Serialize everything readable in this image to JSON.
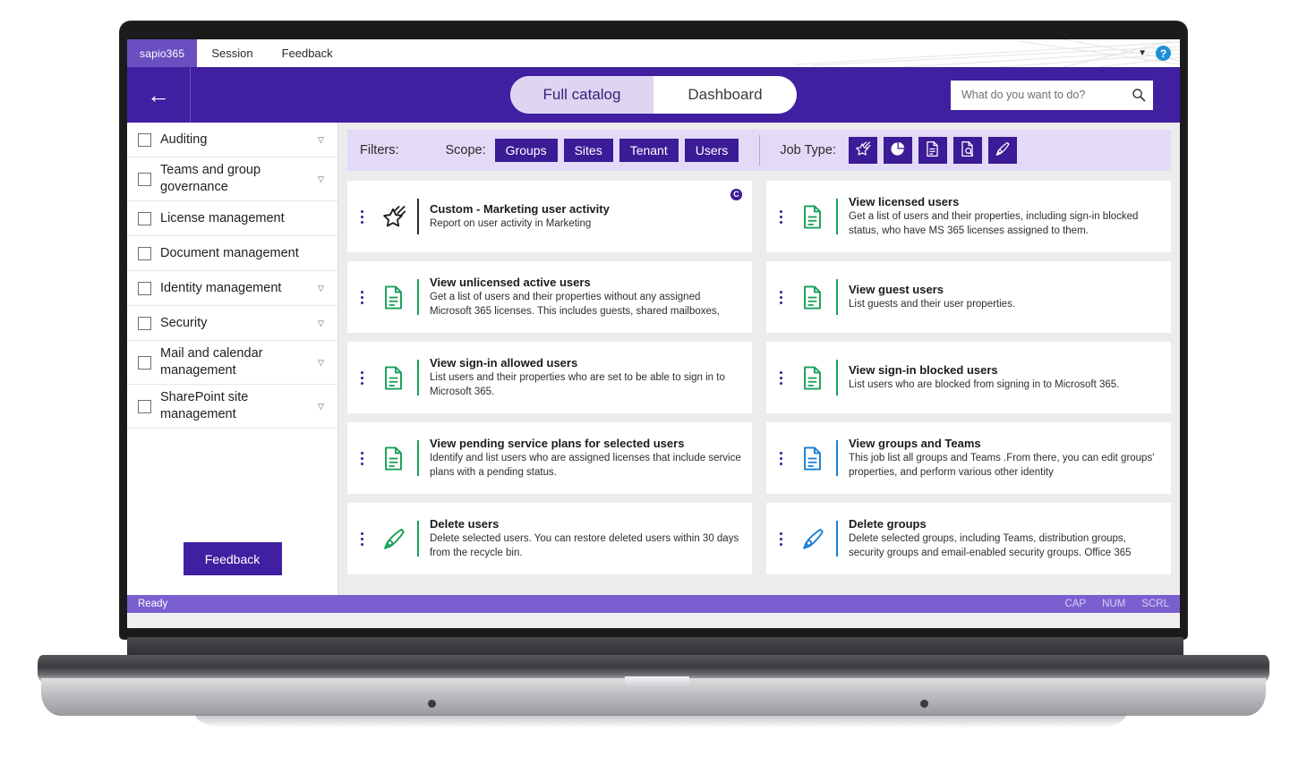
{
  "menubar": {
    "brand": "sapio365",
    "items": [
      "Session",
      "Feedback"
    ],
    "help_icon": "help-circle-icon",
    "chevron_icon": "chevron-down-icon"
  },
  "header": {
    "back_icon": "back-arrow-icon",
    "tabs": [
      {
        "label": "Full catalog",
        "active": true
      },
      {
        "label": "Dashboard",
        "active": false
      }
    ],
    "search": {
      "placeholder": "What do you want to do?",
      "value": "",
      "icon": "search-icon"
    },
    "accent_color": "#4020a0"
  },
  "sidebar": {
    "items": [
      {
        "label": "Auditing",
        "checked": false,
        "has_chevron": true,
        "two_line": false
      },
      {
        "label": "Teams and group governance",
        "checked": false,
        "has_chevron": true,
        "two_line": true
      },
      {
        "label": "License management",
        "checked": false,
        "has_chevron": false,
        "two_line": false
      },
      {
        "label": "Document management",
        "checked": false,
        "has_chevron": false,
        "two_line": false
      },
      {
        "label": "Identity management",
        "checked": false,
        "has_chevron": true,
        "two_line": false
      },
      {
        "label": "Security",
        "checked": false,
        "has_chevron": true,
        "two_line": false
      },
      {
        "label": "Mail and calendar management",
        "checked": false,
        "has_chevron": true,
        "two_line": true
      },
      {
        "label": "SharePoint site management",
        "checked": false,
        "has_chevron": true,
        "two_line": true
      }
    ],
    "feedback_button": "Feedback"
  },
  "filters": {
    "filters_label": "Filters:",
    "scope_label": "Scope:",
    "scope_chips": [
      "Groups",
      "Sites",
      "Tenant",
      "Users"
    ],
    "jobtype_label": "Job Type:",
    "jobtype_icons": [
      "shooting-star-icon",
      "pie-chart-icon",
      "document-icon",
      "document-search-icon",
      "pen-edit-icon"
    ],
    "chip_color": "#3b1b96",
    "bar_color": "#e2daf6"
  },
  "cards": [
    {
      "title": "Custom - Marketing user activity",
      "description": "Report on user activity in Marketing",
      "icon": "shooting-star-icon",
      "icon_color": "#1b1b1b",
      "badge": "C",
      "column": "left"
    },
    {
      "title": "View licensed users",
      "description": "Get a list of users and their properties, including sign-in blocked status, who have MS 365 licenses assigned to them.",
      "icon": "document-icon",
      "icon_color": "#17a05a",
      "badge": "",
      "column": "right"
    },
    {
      "title": "View unlicensed active users",
      "description": "Get a list of users and their properties without any assigned Microsoft 365 licenses. This includes guests, shared mailboxes,",
      "icon": "document-icon",
      "icon_color": "#17a05a",
      "badge": "",
      "column": "left"
    },
    {
      "title": "View guest users",
      "description": "List guests and their user properties.",
      "icon": "document-icon",
      "icon_color": "#17a05a",
      "badge": "",
      "column": "right"
    },
    {
      "title": "View sign-in allowed users",
      "description": "List users and their properties who are set to be able to sign in to Microsoft 365.",
      "icon": "document-icon",
      "icon_color": "#17a05a",
      "badge": "",
      "column": "left"
    },
    {
      "title": "View sign-in blocked users",
      "description": "List users who are blocked from signing in to Microsoft 365.",
      "icon": "document-icon",
      "icon_color": "#17a05a",
      "badge": "",
      "column": "right"
    },
    {
      "title": "View pending service plans for selected users",
      "description": "Identify and list users who are assigned licenses that include service plans with a pending status.",
      "icon": "document-icon",
      "icon_color": "#17a05a",
      "badge": "",
      "column": "left"
    },
    {
      "title": "View groups and Teams",
      "description": "This job list all groups and Teams .From there, you can edit groups' properties, and perform various other identity",
      "icon": "document-icon",
      "icon_color": "#1b7fd4",
      "badge": "",
      "column": "right"
    },
    {
      "title": "Delete users",
      "description": "Delete selected users. You can restore deleted users within 30 days from the recycle bin.",
      "icon": "pen-edit-icon",
      "icon_color": "#17a05a",
      "badge": "",
      "column": "left"
    },
    {
      "title": "Delete groups",
      "description": "Delete selected groups, including Teams, distribution groups, security groups and email-enabled security groups. Office 365",
      "icon": "pen-edit-icon",
      "icon_color": "#1b7fd4",
      "badge": "",
      "column": "right"
    }
  ],
  "statusbar": {
    "status": "Ready",
    "indicators": [
      "CAP",
      "NUM",
      "SCRL"
    ]
  }
}
